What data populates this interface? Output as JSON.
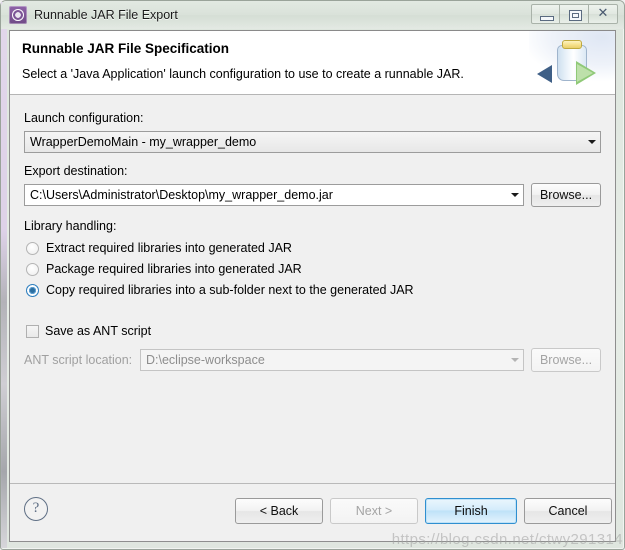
{
  "window": {
    "title": "Runnable JAR File Export",
    "icon": "jar-export-icon",
    "controls": {
      "minimize": "Minimize",
      "maximize": "Maximize",
      "close": "Close",
      "close_glyph": "✕"
    }
  },
  "header": {
    "title": "Runnable JAR File Specification",
    "description": "Select a 'Java Application' launch configuration to use to create a runnable JAR.",
    "banner_icon": "jar-with-arrows-icon"
  },
  "form": {
    "launch_configuration": {
      "label": "Launch configuration:",
      "value": "WrapperDemoMain - my_wrapper_demo"
    },
    "export_destination": {
      "label": "Export destination:",
      "value": "C:\\Users\\Administrator\\Desktop\\my_wrapper_demo.jar",
      "browse_label": "Browse..."
    },
    "library_handling": {
      "label": "Library handling:",
      "options": [
        {
          "label": "Extract required libraries into generated JAR",
          "selected": false
        },
        {
          "label": "Package required libraries into generated JAR",
          "selected": false
        },
        {
          "label": "Copy required libraries into a sub-folder next to the generated JAR",
          "selected": true
        }
      ]
    },
    "save_as_ant": {
      "label": "Save as ANT script",
      "checked": false
    },
    "ant_script_location": {
      "label": "ANT script location:",
      "value": "D:\\eclipse-workspace",
      "browse_label": "Browse...",
      "enabled": false
    }
  },
  "footer": {
    "help_glyph": "?",
    "back_label": "< Back",
    "next_label": "Next >",
    "finish_label": "Finish",
    "cancel_label": "Cancel"
  },
  "watermark": "https://blog.csdn.net/ctwy291314",
  "colors": {
    "accent": "#2f8fd0",
    "window_bg": "#f0f0f0",
    "header_bg": "#ffffff",
    "titlebar": "#dde5dd",
    "radio_selected": "#2b6ea0"
  }
}
